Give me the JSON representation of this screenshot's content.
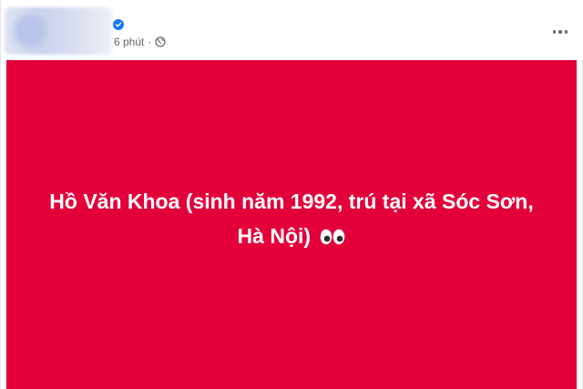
{
  "post": {
    "meta": {
      "time": "6 phút",
      "separator": "·"
    },
    "icons": {
      "verified": "verified-badge-icon",
      "privacy": "globe-icon",
      "more": "more-options-icon",
      "emoji": "eyes-emoji"
    },
    "content": {
      "text": "Hồ Văn Khoa (sinh năm 1992, trú tại xã Sóc Sơn, Hà Nội)",
      "background_color": "#e3003a",
      "text_color": "#ffffff"
    }
  }
}
